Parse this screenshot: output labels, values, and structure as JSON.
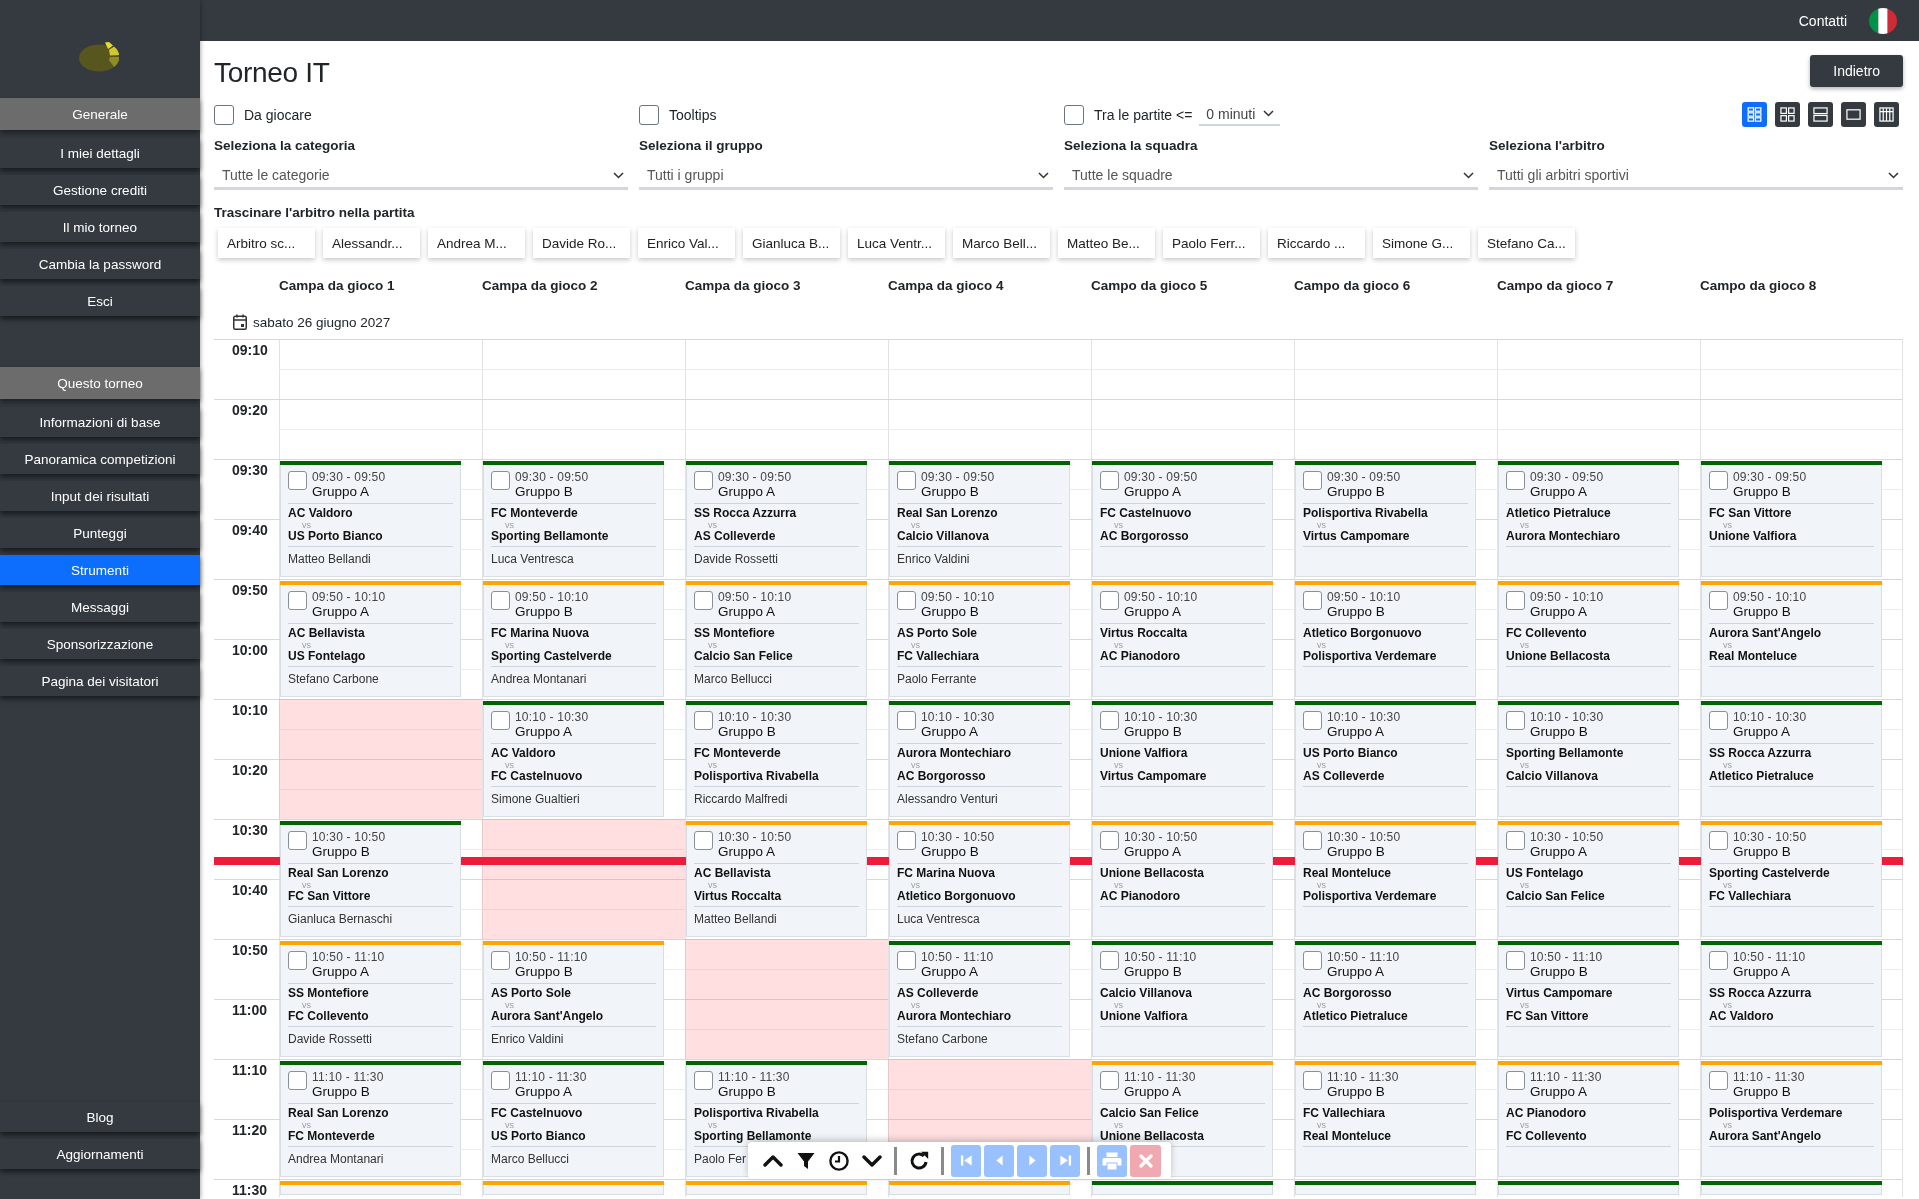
{
  "sidebar": {
    "sections": [
      {
        "title": "Generale",
        "items": [
          {
            "label": "I miei dettagli",
            "selected": false
          },
          {
            "label": "Gestione crediti",
            "selected": false
          },
          {
            "label": "Il mio torneo",
            "selected": false
          },
          {
            "label": "Cambia la password",
            "selected": false
          },
          {
            "label": "Esci",
            "selected": false
          }
        ]
      },
      {
        "title": "Questo torneo",
        "items": [
          {
            "label": "Informazioni di base",
            "selected": false
          },
          {
            "label": "Panoramica competizioni",
            "selected": false
          },
          {
            "label": "Input dei risultati",
            "selected": false
          },
          {
            "label": "Punteggi",
            "selected": false
          },
          {
            "label": "Strumenti",
            "selected": true
          },
          {
            "label": "Messaggi",
            "selected": false
          },
          {
            "label": "Sponsorizzazione",
            "selected": false
          },
          {
            "label": "Pagina dei visitatori",
            "selected": false
          }
        ]
      }
    ],
    "footer_items": [
      {
        "label": "Blog",
        "selected": false
      },
      {
        "label": "Aggiornamenti",
        "selected": false
      }
    ]
  },
  "top_bar": {
    "contact_link": "Contatti"
  },
  "page": {
    "title": "Torneo IT",
    "back_button": "Indietro"
  },
  "options": [
    {
      "label": "Da giocare",
      "checked": false
    },
    {
      "label": "Tooltips",
      "checked": false
    },
    {
      "label": "Tra le partite <=",
      "checked": false,
      "select_value": "0 minuti"
    }
  ],
  "view_modes": [
    {
      "kind": "tiles",
      "selected": true
    },
    {
      "kind": "grid",
      "selected": false
    },
    {
      "kind": "rows",
      "selected": false
    },
    {
      "kind": "single",
      "selected": false
    },
    {
      "kind": "columns",
      "selected": false
    }
  ],
  "filters": [
    {
      "label": "Seleziona la categoria",
      "value": "Tutte le categorie"
    },
    {
      "label": "Seleziona il gruppo",
      "value": "Tutti i gruppi"
    },
    {
      "label": "Seleziona la squadra",
      "value": "Tutte le squadre"
    },
    {
      "label": "Seleziona l'arbitro",
      "value": "Tutti gli arbitri sportivi"
    }
  ],
  "referees": {
    "label": "Trascinare l'arbitro nella partita",
    "chips": [
      "Arbitro sc...",
      "Alessandr...",
      "Andrea M...",
      "Davide Ro...",
      "Enrico Val...",
      "Gianluca B...",
      "Luca Ventr...",
      "Marco Bell...",
      "Matteo Be...",
      "Paolo Ferr...",
      "Riccardo ...",
      "Simone G...",
      "Stefano Ca..."
    ]
  },
  "schedule": {
    "fields": [
      "Campa da gioco 1",
      "Campa da gioco 2",
      "Campa da gioco 3",
      "Campa da gioco 4",
      "Campo da gioco 5",
      "Campo da gioco 6",
      "Campo da gioco 7",
      "Campo da gioco 8"
    ],
    "date": "sabato 26 giugno 2027",
    "rows": [
      {
        "time": "09:10",
        "current_time_line": false
      },
      {
        "time": "09:20",
        "current_time_line": false
      },
      {
        "time": "09:30",
        "current_time_line": false,
        "entries": [
          {
            "kind": "match",
            "color": "#006400",
            "checked": false,
            "time": "09:30 - 09:50",
            "group": "Gruppo A",
            "home": "AC Valdoro",
            "vs": "vs",
            "away": "US Porto Bianco",
            "referee": "Matteo Bellandi"
          },
          {
            "kind": "match",
            "color": "#006400",
            "checked": false,
            "time": "09:30 - 09:50",
            "group": "Gruppo B",
            "home": "FC Monteverde",
            "vs": "vs",
            "away": "Sporting Bellamonte",
            "referee": "Luca Ventresca"
          },
          {
            "kind": "match",
            "color": "#006400",
            "checked": false,
            "time": "09:30 - 09:50",
            "group": "Gruppo A",
            "home": "SS Rocca Azzurra",
            "vs": "vs",
            "away": "AS Colleverde",
            "referee": "Davide Rossetti"
          },
          {
            "kind": "match",
            "color": "#006400",
            "checked": false,
            "time": "09:30 - 09:50",
            "group": "Gruppo B",
            "home": "Real San Lorenzo",
            "vs": "vs",
            "away": "Calcio Villanova",
            "referee": "Enrico Valdini"
          },
          {
            "kind": "match",
            "color": "#006400",
            "checked": false,
            "time": "09:30 - 09:50",
            "group": "Gruppo A",
            "home": "FC Castelnuovo",
            "vs": "vs",
            "away": "AC Borgorosso"
          },
          {
            "kind": "match",
            "color": "#006400",
            "checked": false,
            "time": "09:30 - 09:50",
            "group": "Gruppo B",
            "home": "Polisportiva Rivabella",
            "vs": "vs",
            "away": "Virtus Campomare"
          },
          {
            "kind": "match",
            "color": "#006400",
            "checked": false,
            "time": "09:30 - 09:50",
            "group": "Gruppo A",
            "home": "Atletico Pietraluce",
            "vs": "vs",
            "away": "Aurora Montechiaro"
          },
          {
            "kind": "match",
            "color": "#006400",
            "checked": false,
            "time": "09:30 - 09:50",
            "group": "Gruppo B",
            "home": "FC San Vittore",
            "vs": "vs",
            "away": "Unione Valfiora"
          }
        ]
      },
      {
        "time": "09:40",
        "current_time_line": false
      },
      {
        "time": "09:50",
        "current_time_line": false,
        "entries": [
          {
            "kind": "match",
            "color": "#ffa500",
            "checked": false,
            "time": "09:50 - 10:10",
            "group": "Gruppo A",
            "home": "AC Bellavista",
            "vs": "vs",
            "away": "US Fontelago",
            "referee": "Stefano Carbone"
          },
          {
            "kind": "match",
            "color": "#ffa500",
            "checked": false,
            "time": "09:50 - 10:10",
            "group": "Gruppo B",
            "home": "FC Marina Nuova",
            "vs": "vs",
            "away": "Sporting Castelverde",
            "referee": "Andrea Montanari"
          },
          {
            "kind": "match",
            "color": "#ffa500",
            "checked": false,
            "time": "09:50 - 10:10",
            "group": "Gruppo A",
            "home": "SS Montefiore",
            "vs": "vs",
            "away": "Calcio San Felice",
            "referee": "Marco Bellucci"
          },
          {
            "kind": "match",
            "color": "#ffa500",
            "checked": false,
            "time": "09:50 - 10:10",
            "group": "Gruppo B",
            "home": "AS Porto Sole",
            "vs": "vs",
            "away": "FC Vallechiara",
            "referee": "Paolo Ferrante"
          },
          {
            "kind": "match",
            "color": "#ffa500",
            "checked": false,
            "time": "09:50 - 10:10",
            "group": "Gruppo A",
            "home": "Virtus Roccalta",
            "vs": "vs",
            "away": "AC Pianodoro"
          },
          {
            "kind": "match",
            "color": "#ffa500",
            "checked": false,
            "time": "09:50 - 10:10",
            "group": "Gruppo B",
            "home": "Atletico Borgonuovo",
            "vs": "vs",
            "away": "Polisportiva Verdemare"
          },
          {
            "kind": "match",
            "color": "#ffa500",
            "checked": false,
            "time": "09:50 - 10:10",
            "group": "Gruppo A",
            "home": "FC Collevento",
            "vs": "vs",
            "away": "Unione Bellacosta"
          },
          {
            "kind": "match",
            "color": "#ffa500",
            "checked": false,
            "time": "09:50 - 10:10",
            "group": "Gruppo B",
            "home": "Aurora Sant'Angelo",
            "vs": "vs",
            "away": "Real Monteluce"
          }
        ]
      },
      {
        "time": "10:00",
        "current_time_line": false
      },
      {
        "time": "10:10",
        "current_time_line": false,
        "entries": [
          {
            "kind": "blocked"
          },
          {
            "kind": "match",
            "color": "#006400",
            "checked": false,
            "time": "10:10 - 10:30",
            "group": "Gruppo A",
            "home": "AC Valdoro",
            "vs": "vs",
            "away": "FC Castelnuovo",
            "referee": "Simone Gualtieri"
          },
          {
            "kind": "match",
            "color": "#006400",
            "checked": false,
            "time": "10:10 - 10:30",
            "group": "Gruppo B",
            "home": "FC Monteverde",
            "vs": "vs",
            "away": "Polisportiva Rivabella",
            "referee": "Riccardo Malfredi"
          },
          {
            "kind": "match",
            "color": "#006400",
            "checked": false,
            "time": "10:10 - 10:30",
            "group": "Gruppo A",
            "home": "Aurora Montechiaro",
            "vs": "vs",
            "away": "AC Borgorosso",
            "referee": "Alessandro Venturi"
          },
          {
            "kind": "match",
            "color": "#006400",
            "checked": false,
            "time": "10:10 - 10:30",
            "group": "Gruppo B",
            "home": "Unione Valfiora",
            "vs": "vs",
            "away": "Virtus Campomare"
          },
          {
            "kind": "match",
            "color": "#006400",
            "checked": false,
            "time": "10:10 - 10:30",
            "group": "Gruppo A",
            "home": "US Porto Bianco",
            "vs": "vs",
            "away": "AS Colleverde"
          },
          {
            "kind": "match",
            "color": "#006400",
            "checked": false,
            "time": "10:10 - 10:30",
            "group": "Gruppo B",
            "home": "Sporting Bellamonte",
            "vs": "vs",
            "away": "Calcio Villanova"
          },
          {
            "kind": "match",
            "color": "#006400",
            "checked": false,
            "time": "10:10 - 10:30",
            "group": "Gruppo A",
            "home": "SS Rocca Azzurra",
            "vs": "vs",
            "away": "Atletico Pietraluce"
          }
        ]
      },
      {
        "time": "10:20",
        "current_time_line": false
      },
      {
        "time": "10:30",
        "current_time_line": true,
        "entries": [
          {
            "kind": "match",
            "color": "#006400",
            "checked": false,
            "time": "10:30 - 10:50",
            "group": "Gruppo B",
            "home": "Real San Lorenzo",
            "vs": "vs",
            "away": "FC San Vittore",
            "referee": "Gianluca Bernaschi"
          },
          {
            "kind": "blocked"
          },
          {
            "kind": "match",
            "color": "#ffa500",
            "checked": false,
            "time": "10:30 - 10:50",
            "group": "Gruppo A",
            "home": "AC Bellavista",
            "vs": "vs",
            "away": "Virtus Roccalta",
            "referee": "Matteo Bellandi"
          },
          {
            "kind": "match",
            "color": "#ffa500",
            "checked": false,
            "time": "10:30 - 10:50",
            "group": "Gruppo B",
            "home": "FC Marina Nuova",
            "vs": "vs",
            "away": "Atletico Borgonuovo",
            "referee": "Luca Ventresca"
          },
          {
            "kind": "match",
            "color": "#ffa500",
            "checked": false,
            "time": "10:30 - 10:50",
            "group": "Gruppo A",
            "home": "Unione Bellacosta",
            "vs": "vs",
            "away": "AC Pianodoro"
          },
          {
            "kind": "match",
            "color": "#ffa500",
            "checked": false,
            "time": "10:30 - 10:50",
            "group": "Gruppo B",
            "home": "Real Monteluce",
            "vs": "vs",
            "away": "Polisportiva Verdemare"
          },
          {
            "kind": "match",
            "color": "#ffa500",
            "checked": false,
            "time": "10:30 - 10:50",
            "group": "Gruppo A",
            "home": "US Fontelago",
            "vs": "vs",
            "away": "Calcio San Felice"
          },
          {
            "kind": "match",
            "color": "#ffa500",
            "checked": false,
            "time": "10:30 - 10:50",
            "group": "Gruppo B",
            "home": "Sporting Castelverde",
            "vs": "vs",
            "away": "FC Vallechiara"
          }
        ]
      },
      {
        "time": "10:40",
        "current_time_line": false
      },
      {
        "time": "10:50",
        "current_time_line": false,
        "entries": [
          {
            "kind": "match",
            "color": "#ffa500",
            "checked": false,
            "time": "10:50 - 11:10",
            "group": "Gruppo A",
            "home": "SS Montefiore",
            "vs": "vs",
            "away": "FC Collevento",
            "referee": "Davide Rossetti"
          },
          {
            "kind": "match",
            "color": "#ffa500",
            "checked": false,
            "time": "10:50 - 11:10",
            "group": "Gruppo B",
            "home": "AS Porto Sole",
            "vs": "vs",
            "away": "Aurora Sant'Angelo",
            "referee": "Enrico Valdini"
          },
          {
            "kind": "blocked"
          },
          {
            "kind": "match",
            "color": "#006400",
            "checked": false,
            "time": "10:50 - 11:10",
            "group": "Gruppo A",
            "home": "AS Colleverde",
            "vs": "vs",
            "away": "Aurora Montechiaro",
            "referee": "Stefano Carbone"
          },
          {
            "kind": "match",
            "color": "#006400",
            "checked": false,
            "time": "10:50 - 11:10",
            "group": "Gruppo B",
            "home": "Calcio Villanova",
            "vs": "vs",
            "away": "Unione Valfiora"
          },
          {
            "kind": "match",
            "color": "#006400",
            "checked": false,
            "time": "10:50 - 11:10",
            "group": "Gruppo A",
            "home": "AC Borgorosso",
            "vs": "vs",
            "away": "Atletico Pietraluce"
          },
          {
            "kind": "match",
            "color": "#006400",
            "checked": false,
            "time": "10:50 - 11:10",
            "group": "Gruppo B",
            "home": "Virtus Campomare",
            "vs": "vs",
            "away": "FC San Vittore"
          },
          {
            "kind": "match",
            "color": "#006400",
            "checked": false,
            "time": "10:50 - 11:10",
            "group": "Gruppo A",
            "home": "SS Rocca Azzurra",
            "vs": "vs",
            "away": "AC Valdoro"
          }
        ]
      },
      {
        "time": "11:00",
        "current_time_line": false
      },
      {
        "time": "11:10",
        "current_time_line": false,
        "entries": [
          {
            "kind": "match",
            "color": "#006400",
            "checked": false,
            "time": "11:10 - 11:30",
            "group": "Gruppo B",
            "home": "Real San Lorenzo",
            "vs": "vs",
            "away": "FC Monteverde",
            "referee": "Andrea Montanari"
          },
          {
            "kind": "match",
            "color": "#006400",
            "checked": false,
            "time": "11:10 - 11:30",
            "group": "Gruppo A",
            "home": "FC Castelnuovo",
            "vs": "vs",
            "away": "US Porto Bianco",
            "referee": "Marco Bellucci"
          },
          {
            "kind": "match",
            "color": "#006400",
            "checked": false,
            "time": "11:10 - 11:30",
            "group": "Gruppo B",
            "home": "Polisportiva Rivabella",
            "vs": "vs",
            "away": "Sporting Bellamonte",
            "referee": "Paolo Fer"
          },
          {
            "kind": "blocked"
          },
          {
            "kind": "match",
            "color": "#ffa500",
            "checked": false,
            "time": "11:10 - 11:30",
            "group": "Gruppo A",
            "home": "Calcio San Felice",
            "vs": "vs",
            "away": "Unione Bellacosta"
          },
          {
            "kind": "match",
            "color": "#ffa500",
            "checked": false,
            "time": "11:10 - 11:30",
            "group": "Gruppo B",
            "home": "FC Vallechiara",
            "vs": "vs",
            "away": "Real Monteluce"
          },
          {
            "kind": "match",
            "color": "#ffa500",
            "checked": false,
            "time": "11:10 - 11:30",
            "group": "Gruppo A",
            "home": "AC Pianodoro",
            "vs": "vs",
            "away": "FC Collevento"
          },
          {
            "kind": "match",
            "color": "#ffa500",
            "checked": false,
            "time": "11:10 - 11:30",
            "group": "Gruppo B",
            "home": "Polisportiva Verdemare",
            "vs": "vs",
            "away": "Aurora Sant'Angelo"
          }
        ]
      },
      {
        "time": "11:20",
        "current_time_line": false
      },
      {
        "time": "11:30",
        "current_time_line": false,
        "entries": [
          {
            "kind": "match",
            "color": "#ffa500"
          },
          {
            "kind": "match",
            "color": "#ffa500"
          },
          {
            "kind": "match",
            "color": "#ffa500"
          },
          {
            "kind": "match",
            "color": "#ffa500"
          },
          {
            "kind": "match",
            "color": "#006400"
          },
          {
            "kind": "match",
            "color": "#006400"
          },
          {
            "kind": "match",
            "color": "#006400"
          },
          {
            "kind": "match",
            "color": "#006400"
          }
        ]
      }
    ]
  },
  "toolbar": {
    "groups": [
      {
        "buttons": [
          {
            "kind": "up",
            "disabled": false
          },
          {
            "kind": "filter",
            "disabled": false
          },
          {
            "kind": "clock",
            "disabled": false
          },
          {
            "kind": "down",
            "disabled": false
          }
        ]
      },
      {
        "buttons": [
          {
            "kind": "refresh",
            "disabled": false
          }
        ]
      },
      {
        "buttons": [
          {
            "kind": "first",
            "disabled": true
          },
          {
            "kind": "previous",
            "disabled": true
          },
          {
            "kind": "next",
            "disabled": true
          },
          {
            "kind": "last",
            "disabled": true
          }
        ]
      },
      {
        "buttons": [
          {
            "kind": "print",
            "disabled": true
          },
          {
            "kind": "close",
            "disabled": true
          }
        ]
      }
    ]
  }
}
